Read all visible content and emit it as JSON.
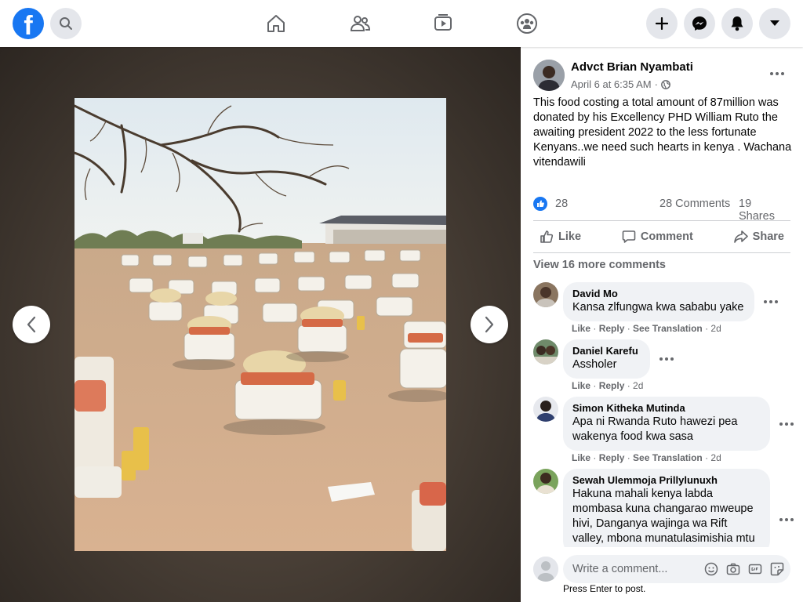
{
  "header": {
    "logo_letter": "f",
    "nav": [
      "home-icon",
      "friends-icon",
      "watch-icon",
      "groups-icon"
    ],
    "right_buttons": [
      "create-icon",
      "messenger-icon",
      "notifications-icon",
      "account-menu-icon"
    ]
  },
  "post": {
    "author": "Advct Brian Nyambati",
    "date": "April 6 at 6:35 AM",
    "dot": "·",
    "privacy_icon": "globe-icon",
    "text": "This food costing a total amount of 87million was donated by his Excellency PHD William Ruto the awaiting president 2022 to the less fortunate Kenyans..we need such hearts in kenya . Wachana vitendawili",
    "reaction_count": "28",
    "comments_count": "28 Comments",
    "shares_count": "19 Shares"
  },
  "actions": {
    "like": "Like",
    "comment": "Comment",
    "share": "Share"
  },
  "view_more": "View 16 more comments",
  "comments": [
    {
      "name": "David Mo",
      "text": "Kansa zlfungwa kwa sababu yake",
      "like": "Like",
      "reply": "Reply",
      "translate": "See Translation",
      "time": "2d"
    },
    {
      "name": "Daniel Karefu",
      "text": "Assholer",
      "like": "Like",
      "reply": "Reply",
      "time": "2d"
    },
    {
      "name": "Simon Kitheka Mutinda",
      "text": "Apa ni Rwanda Ruto hawezi pea wakenya food kwa sasa",
      "like": "Like",
      "reply": "Reply",
      "translate": "See Translation",
      "time": "2d"
    },
    {
      "name": "Sewah Ulemmoja Prillylunuxh",
      "text": "Hakuna mahali kenya labda mombasa kuna changarao mweupe hivi, Danganya wajinga wa Rift valley, mbona munatulasimishia mtu"
    }
  ],
  "composer": {
    "placeholder": "Write a comment...",
    "hint": "Press Enter to post.",
    "icons": [
      "emoji-icon",
      "camera-icon",
      "gif-icon",
      "sticker-icon"
    ]
  },
  "colors": {
    "brand": "#1877f2",
    "secondary_text": "#65676b",
    "bubble": "#f0f2f5"
  }
}
